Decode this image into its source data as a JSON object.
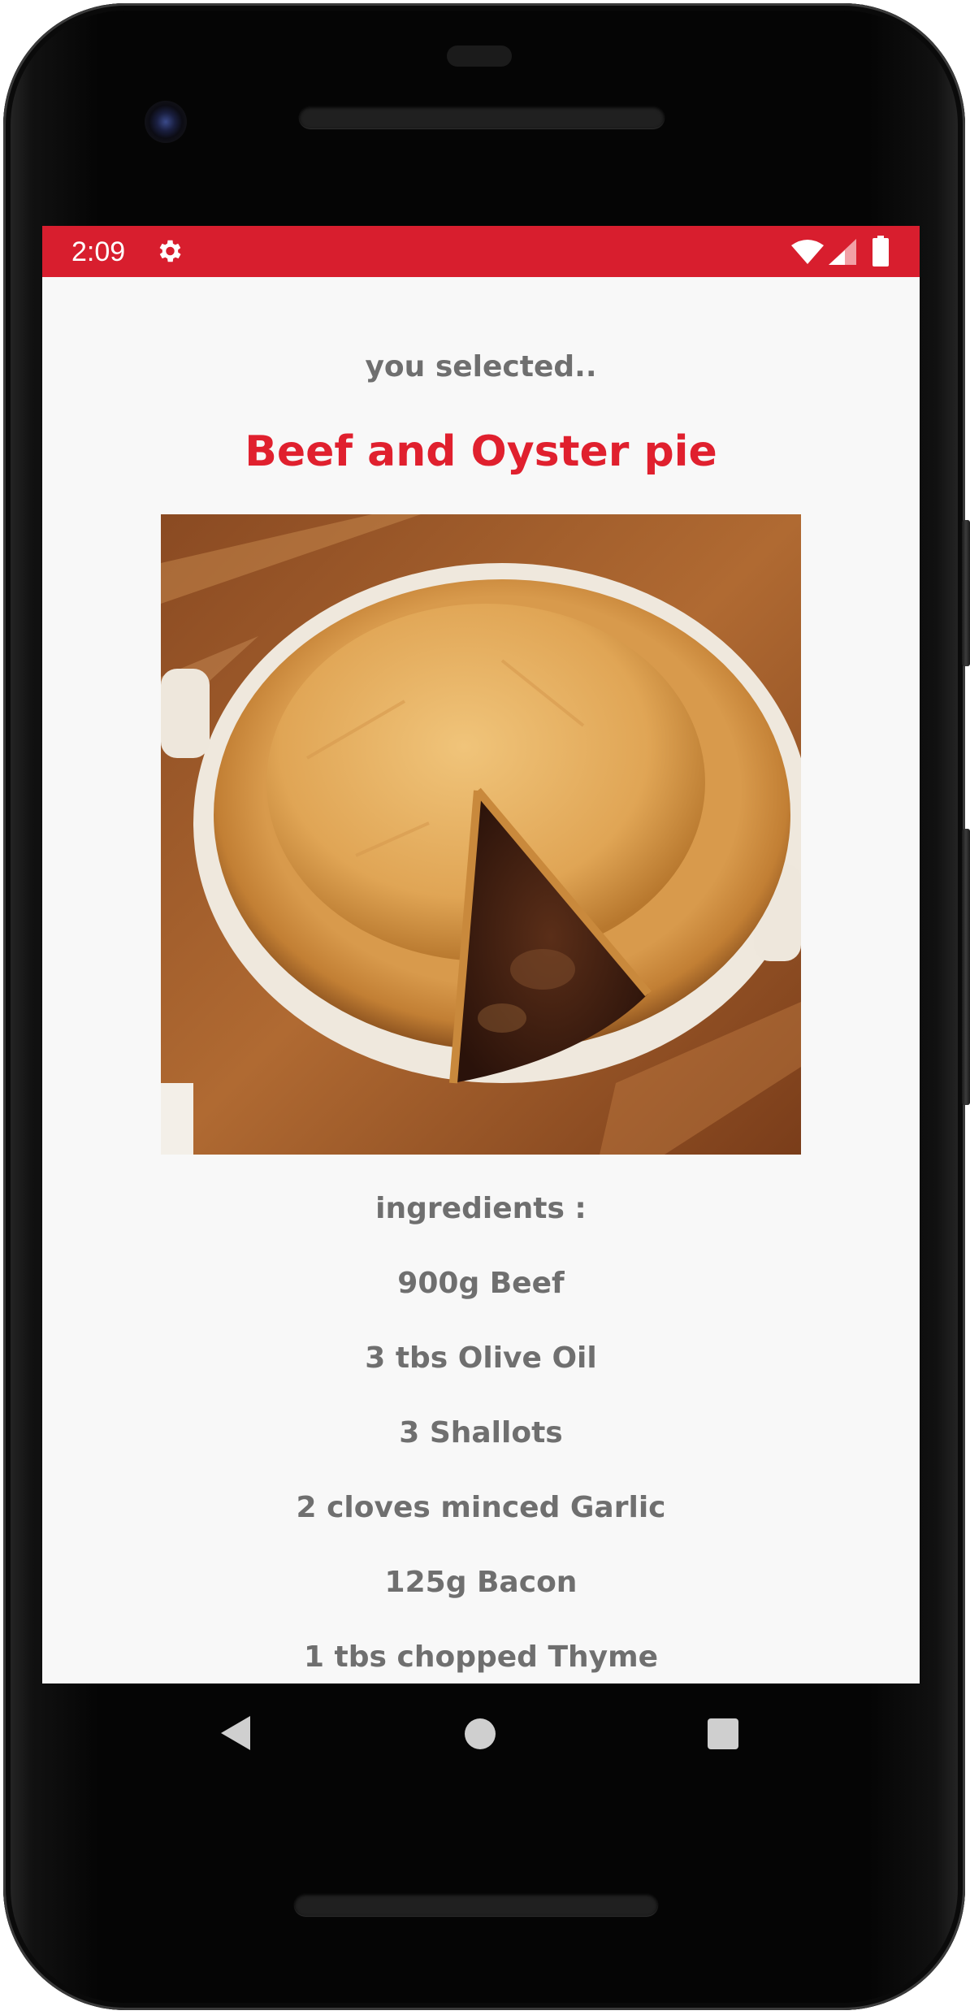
{
  "status_bar": {
    "time": "2:09",
    "background_color": "#d81e2e",
    "icons": [
      "gear-icon",
      "wifi-icon",
      "signal-icon",
      "battery-icon"
    ]
  },
  "header": {
    "subtitle": "you selected..",
    "title": "Beef and Oyster pie",
    "title_color": "#e0202e"
  },
  "image": {
    "subject": "beef-and-oyster-pie-photo"
  },
  "ingredients": {
    "heading": "ingredients :",
    "items": [
      "900g Beef",
      "3 tbs Olive Oil",
      "3 Shallots",
      "2 cloves minced Garlic",
      "125g Bacon",
      "1 tbs chopped Thyme"
    ]
  },
  "navigation": {
    "buttons": [
      "back-icon",
      "home-icon",
      "recents-icon"
    ]
  }
}
